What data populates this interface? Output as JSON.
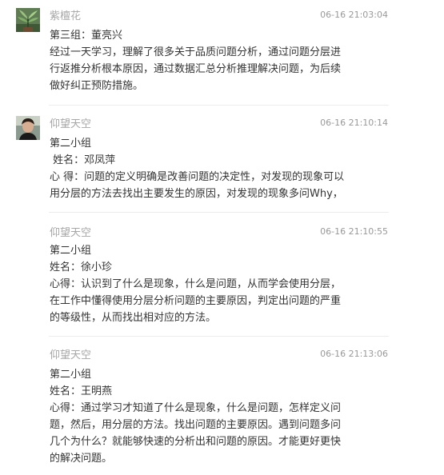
{
  "comments": [
    {
      "author": "紫檀花",
      "time": "06-16 21:03:04",
      "avatar_icon": "plant-avatar-icon",
      "lines": [
        "第三组：董亮兴",
        "经过一天学习，理解了很多关于品质问题分析，通过问题分层进",
        "行返推分析根本原因，通过数据汇总分析推理解决问题，为后续",
        "做好纠正预防措施。"
      ]
    },
    {
      "author": "仰望天空",
      "time": "06-16 21:10:14",
      "avatar_icon": "person-avatar-icon",
      "lines": [
        "第二小组",
        " 姓名：邓凤萍",
        "心 得：问题的定义明确是改善问题的决定性，对发现的现象可以",
        "用分层的方法去找出主要发生的原因，对发现的现象多问Why，"
      ]
    },
    {
      "author": "仰望天空",
      "time": "06-16 21:10:55",
      "lines": [
        "第二小组",
        "姓名：徐小珍",
        "心得：认识到了什么是现象，什么是问题，从而学会使用分层，",
        "在工作中懂得使用分层分析问题的主要原因，判定出问题的严重",
        "的等级性，从而找出相对应的方法。"
      ]
    },
    {
      "author": "仰望天空",
      "time": "06-16 21:13:06",
      "lines": [
        "第二小组",
        "姓名：王明燕",
        "心得：通过学习才知道了什么是现象，什么是问题，怎样定义问",
        "题，然后，用分层的方法。找出问题的主要原因。遇到问题多问",
        "几个为什么？就能够快速的分析出和问题的原因。才能更好更快",
        "的解决问题。"
      ]
    }
  ]
}
